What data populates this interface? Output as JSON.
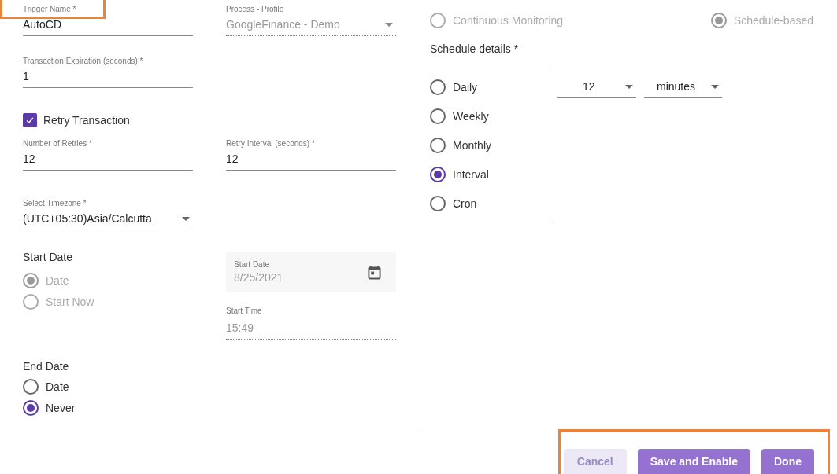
{
  "trigger_name": {
    "label": "Trigger Name *",
    "value": "AutoCD"
  },
  "process_profile": {
    "label": "Process - Profile",
    "value": "GoogleFinance - Demo",
    "disabled": true
  },
  "transaction_expiration": {
    "label": "Transaction Expiration (seconds) *",
    "value": "1"
  },
  "retry": {
    "label": "Retry Transaction",
    "checked": true
  },
  "number_of_retries": {
    "label": "Number of Retries *",
    "value": "12"
  },
  "retry_interval": {
    "label": "Retry Interval (seconds) *",
    "value": "12"
  },
  "timezone": {
    "label": "Select Timezone *",
    "value": "(UTC+05:30)Asia/Calcutta"
  },
  "start_date": {
    "heading": "Start Date",
    "options": [
      {
        "label": "Date",
        "selected": true,
        "disabled": true
      },
      {
        "label": "Start Now",
        "selected": false,
        "disabled": true
      }
    ],
    "date_field": {
      "label": "Start Date",
      "value": "8/25/2021",
      "disabled": true
    },
    "time_field": {
      "label": "Start Time",
      "value": "15:49",
      "disabled": true
    }
  },
  "end_date": {
    "heading": "End Date",
    "options": [
      {
        "label": "Date",
        "selected": false,
        "disabled": false
      },
      {
        "label": "Never",
        "selected": true,
        "disabled": false
      }
    ]
  },
  "mode_options": [
    {
      "label": "Continuous Monitoring",
      "selected": false,
      "disabled": true
    },
    {
      "label": "Schedule-based",
      "selected": true,
      "disabled": true
    }
  ],
  "schedule": {
    "heading": "Schedule details *",
    "frequencies": [
      {
        "label": "Daily",
        "selected": false,
        "disabled": false
      },
      {
        "label": "Weekly",
        "selected": false,
        "disabled": false
      },
      {
        "label": "Monthly",
        "selected": false,
        "disabled": false
      },
      {
        "label": "Interval",
        "selected": true,
        "disabled": false
      },
      {
        "label": "Cron",
        "selected": false,
        "disabled": false
      }
    ],
    "interval_value": "12",
    "interval_unit": "minutes"
  },
  "buttons": [
    {
      "label": "Cancel",
      "kind": "secondary"
    },
    {
      "label": "Save and Enable",
      "kind": "primary"
    },
    {
      "label": "Done",
      "kind": "primary"
    }
  ]
}
